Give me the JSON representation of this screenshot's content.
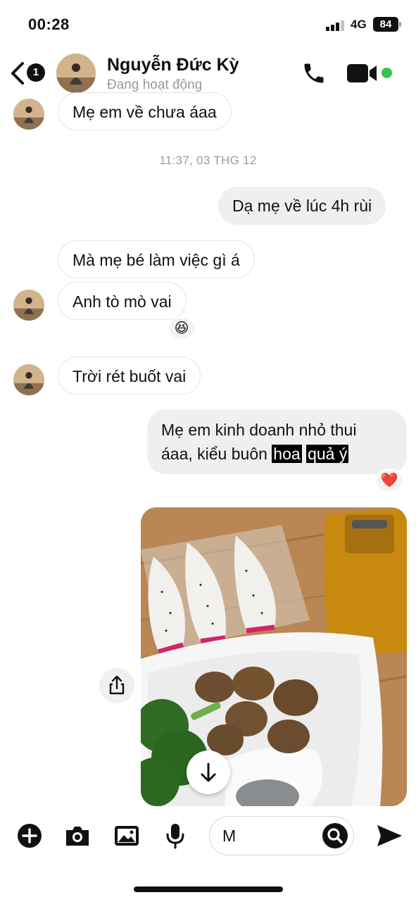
{
  "status_bar": {
    "time": "00:28",
    "network": "4G",
    "battery": "84"
  },
  "header": {
    "back_badge": "1",
    "contact_name": "Nguyễn Đức Kỳ",
    "contact_status": "Đang hoạt động",
    "online_color": "#31c451",
    "icons": [
      "back-chevron-icon",
      "phone-icon",
      "video-camera-icon"
    ]
  },
  "messages": [
    {
      "from": "contact",
      "text": "Mẹ em về chưa áaa"
    },
    {
      "type": "timestamp",
      "text": "11:37, 03 THG 12"
    },
    {
      "from": "me",
      "text": "Dạ mẹ về lúc 4h rùi"
    },
    {
      "from": "contact",
      "text": "Mà mẹ bé làm việc gì á"
    },
    {
      "from": "contact",
      "text": "Anh tò mò vai",
      "reaction": "😆"
    },
    {
      "from": "contact",
      "text": "Trời rét buốt vai"
    },
    {
      "from": "me",
      "line1": "Mẹ em kinh doanh nhỏ thui",
      "line2_prefix": "áaa, kiểu buôn ",
      "highlight1": "hoa",
      "highlight2": "quả ý",
      "reaction": "❤️"
    },
    {
      "from": "me",
      "type": "photo",
      "icon": "food-photo"
    }
  ],
  "composer": {
    "input_value": "M",
    "tools": [
      "plus-icon",
      "camera-icon",
      "image-icon",
      "microphone-icon"
    ],
    "send_icon": "send-icon",
    "search_icon": "search-icon"
  },
  "colors": {
    "outgoing_bubble": "#efefef",
    "incoming_border": "#e3e3e3",
    "timestamp": "#9c9c9c"
  }
}
